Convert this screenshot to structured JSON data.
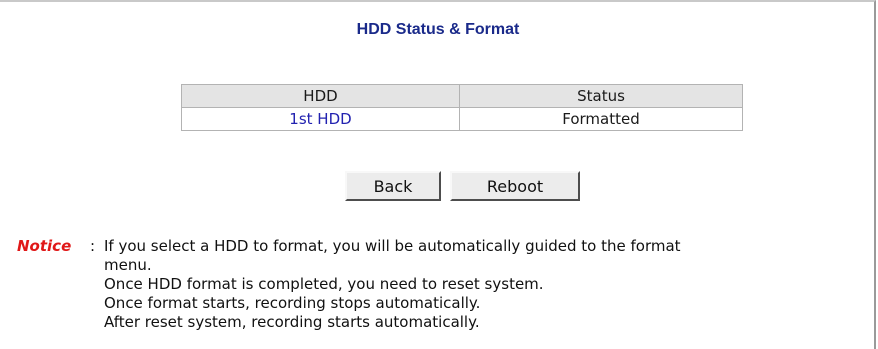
{
  "page": {
    "title": "HDD Status & Format"
  },
  "table": {
    "headers": [
      "HDD",
      "Status"
    ],
    "rows": [
      {
        "hdd": "1st HDD",
        "status": "Formatted"
      }
    ]
  },
  "buttons": {
    "back": "Back",
    "reboot": "Reboot"
  },
  "notice": {
    "label": "Notice",
    "separator": ":",
    "lines": [
      "If you select a HDD to format, you will be automatically guided to the format",
      "menu.",
      "Once HDD format is completed, you need to reset system.",
      "Once format starts, recording stops automatically.",
      "After reset system, recording starts automatically."
    ]
  },
  "colors": {
    "title": "#1a2a8a",
    "link": "#2222b0",
    "notice_label": "#e01818",
    "header_bg": "#e4e4e4",
    "border": "#b3b3b3"
  }
}
